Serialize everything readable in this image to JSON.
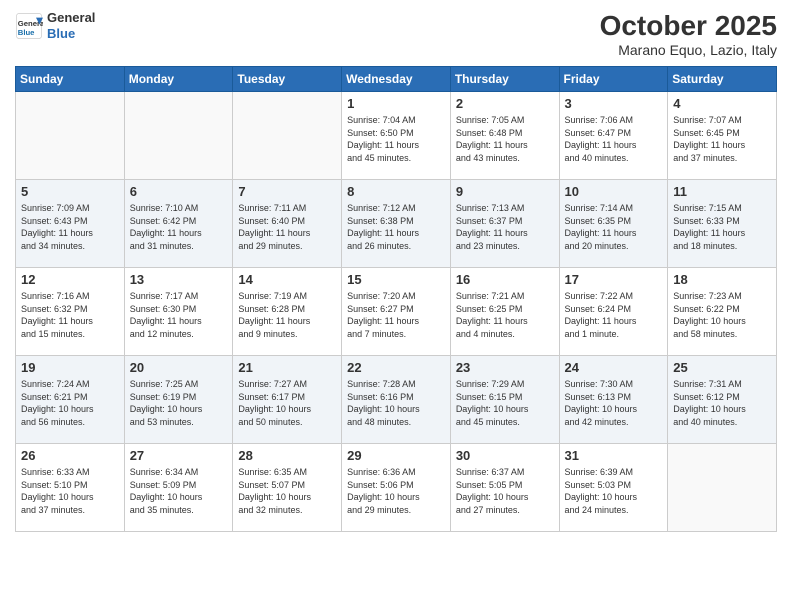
{
  "header": {
    "logo_line1": "General",
    "logo_line2": "Blue",
    "month": "October 2025",
    "location": "Marano Equo, Lazio, Italy"
  },
  "weekdays": [
    "Sunday",
    "Monday",
    "Tuesday",
    "Wednesday",
    "Thursday",
    "Friday",
    "Saturday"
  ],
  "weeks": [
    [
      {
        "day": "",
        "info": ""
      },
      {
        "day": "",
        "info": ""
      },
      {
        "day": "",
        "info": ""
      },
      {
        "day": "1",
        "info": "Sunrise: 7:04 AM\nSunset: 6:50 PM\nDaylight: 11 hours\nand 45 minutes."
      },
      {
        "day": "2",
        "info": "Sunrise: 7:05 AM\nSunset: 6:48 PM\nDaylight: 11 hours\nand 43 minutes."
      },
      {
        "day": "3",
        "info": "Sunrise: 7:06 AM\nSunset: 6:47 PM\nDaylight: 11 hours\nand 40 minutes."
      },
      {
        "day": "4",
        "info": "Sunrise: 7:07 AM\nSunset: 6:45 PM\nDaylight: 11 hours\nand 37 minutes."
      }
    ],
    [
      {
        "day": "5",
        "info": "Sunrise: 7:09 AM\nSunset: 6:43 PM\nDaylight: 11 hours\nand 34 minutes."
      },
      {
        "day": "6",
        "info": "Sunrise: 7:10 AM\nSunset: 6:42 PM\nDaylight: 11 hours\nand 31 minutes."
      },
      {
        "day": "7",
        "info": "Sunrise: 7:11 AM\nSunset: 6:40 PM\nDaylight: 11 hours\nand 29 minutes."
      },
      {
        "day": "8",
        "info": "Sunrise: 7:12 AM\nSunset: 6:38 PM\nDaylight: 11 hours\nand 26 minutes."
      },
      {
        "day": "9",
        "info": "Sunrise: 7:13 AM\nSunset: 6:37 PM\nDaylight: 11 hours\nand 23 minutes."
      },
      {
        "day": "10",
        "info": "Sunrise: 7:14 AM\nSunset: 6:35 PM\nDaylight: 11 hours\nand 20 minutes."
      },
      {
        "day": "11",
        "info": "Sunrise: 7:15 AM\nSunset: 6:33 PM\nDaylight: 11 hours\nand 18 minutes."
      }
    ],
    [
      {
        "day": "12",
        "info": "Sunrise: 7:16 AM\nSunset: 6:32 PM\nDaylight: 11 hours\nand 15 minutes."
      },
      {
        "day": "13",
        "info": "Sunrise: 7:17 AM\nSunset: 6:30 PM\nDaylight: 11 hours\nand 12 minutes."
      },
      {
        "day": "14",
        "info": "Sunrise: 7:19 AM\nSunset: 6:28 PM\nDaylight: 11 hours\nand 9 minutes."
      },
      {
        "day": "15",
        "info": "Sunrise: 7:20 AM\nSunset: 6:27 PM\nDaylight: 11 hours\nand 7 minutes."
      },
      {
        "day": "16",
        "info": "Sunrise: 7:21 AM\nSunset: 6:25 PM\nDaylight: 11 hours\nand 4 minutes."
      },
      {
        "day": "17",
        "info": "Sunrise: 7:22 AM\nSunset: 6:24 PM\nDaylight: 11 hours\nand 1 minute."
      },
      {
        "day": "18",
        "info": "Sunrise: 7:23 AM\nSunset: 6:22 PM\nDaylight: 10 hours\nand 58 minutes."
      }
    ],
    [
      {
        "day": "19",
        "info": "Sunrise: 7:24 AM\nSunset: 6:21 PM\nDaylight: 10 hours\nand 56 minutes."
      },
      {
        "day": "20",
        "info": "Sunrise: 7:25 AM\nSunset: 6:19 PM\nDaylight: 10 hours\nand 53 minutes."
      },
      {
        "day": "21",
        "info": "Sunrise: 7:27 AM\nSunset: 6:17 PM\nDaylight: 10 hours\nand 50 minutes."
      },
      {
        "day": "22",
        "info": "Sunrise: 7:28 AM\nSunset: 6:16 PM\nDaylight: 10 hours\nand 48 minutes."
      },
      {
        "day": "23",
        "info": "Sunrise: 7:29 AM\nSunset: 6:15 PM\nDaylight: 10 hours\nand 45 minutes."
      },
      {
        "day": "24",
        "info": "Sunrise: 7:30 AM\nSunset: 6:13 PM\nDaylight: 10 hours\nand 42 minutes."
      },
      {
        "day": "25",
        "info": "Sunrise: 7:31 AM\nSunset: 6:12 PM\nDaylight: 10 hours\nand 40 minutes."
      }
    ],
    [
      {
        "day": "26",
        "info": "Sunrise: 6:33 AM\nSunset: 5:10 PM\nDaylight: 10 hours\nand 37 minutes."
      },
      {
        "day": "27",
        "info": "Sunrise: 6:34 AM\nSunset: 5:09 PM\nDaylight: 10 hours\nand 35 minutes."
      },
      {
        "day": "28",
        "info": "Sunrise: 6:35 AM\nSunset: 5:07 PM\nDaylight: 10 hours\nand 32 minutes."
      },
      {
        "day": "29",
        "info": "Sunrise: 6:36 AM\nSunset: 5:06 PM\nDaylight: 10 hours\nand 29 minutes."
      },
      {
        "day": "30",
        "info": "Sunrise: 6:37 AM\nSunset: 5:05 PM\nDaylight: 10 hours\nand 27 minutes."
      },
      {
        "day": "31",
        "info": "Sunrise: 6:39 AM\nSunset: 5:03 PM\nDaylight: 10 hours\nand 24 minutes."
      },
      {
        "day": "",
        "info": ""
      }
    ]
  ]
}
